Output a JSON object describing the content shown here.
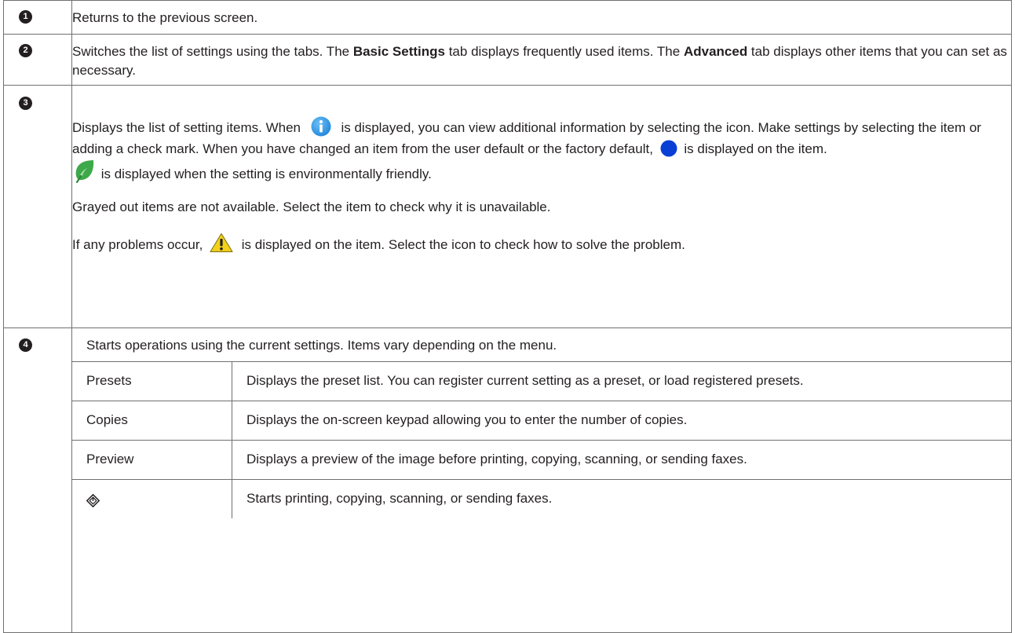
{
  "rows": [
    {
      "number": "1",
      "text": "Returns to the previous screen."
    },
    {
      "number": "2",
      "line1_before": "Switches the list of settings using the tabs. The ",
      "basic_label": "Basic Settings",
      "line1_mid": " tab displays frequently used items. The ",
      "advanced_label": "Advanced",
      "line1_after": " tab displays other items that you can set as necessary."
    },
    {
      "number": "3",
      "p1_before_info": "Displays the list of setting items. When ",
      "p1_after_info": " is displayed, you can view additional information by selecting the icon. Make settings by selecting the item or adding a check mark. When you have changed an item from the user default or the factory default, ",
      "p1_after_dot": " is displayed on the item.",
      "p2_after_leaf": " is displayed when the setting is environmentally friendly.",
      "p3": "Grayed out items are not available. Select the item to check why it is unavailable.",
      "p4_before_warn": "If any problems occur, ",
      "p4_after_warn": " is displayed on the item. Select the icon to check how to solve the problem."
    },
    {
      "number": "4",
      "intro": "Starts operations using the current settings. Items vary depending on the menu.",
      "items": [
        {
          "key": "Presets",
          "desc": "Displays the preset list. You can register current setting as a preset, or load registered presets."
        },
        {
          "key": "Copies",
          "desc": "Displays the on-screen keypad allowing you to enter the number of copies."
        },
        {
          "key": "Preview",
          "desc": "Displays a preview of the image before printing, copying, scanning, or sending faxes."
        },
        {
          "key_icon": "start-icon",
          "desc": "Starts printing, copying, scanning, or sending faxes."
        }
      ]
    }
  ],
  "icons": {
    "info": "info-icon",
    "dot": "changed-dot-icon",
    "leaf": "eco-leaf-icon",
    "warning": "warning-icon",
    "start": "start-icon"
  },
  "colors": {
    "info_blue": "#2f97e8",
    "dot_blue": "#0a3fd6",
    "leaf_green": "#3ea94a",
    "warn_yellow": "#f3d11a",
    "border": "#707070",
    "text": "#231f20"
  }
}
